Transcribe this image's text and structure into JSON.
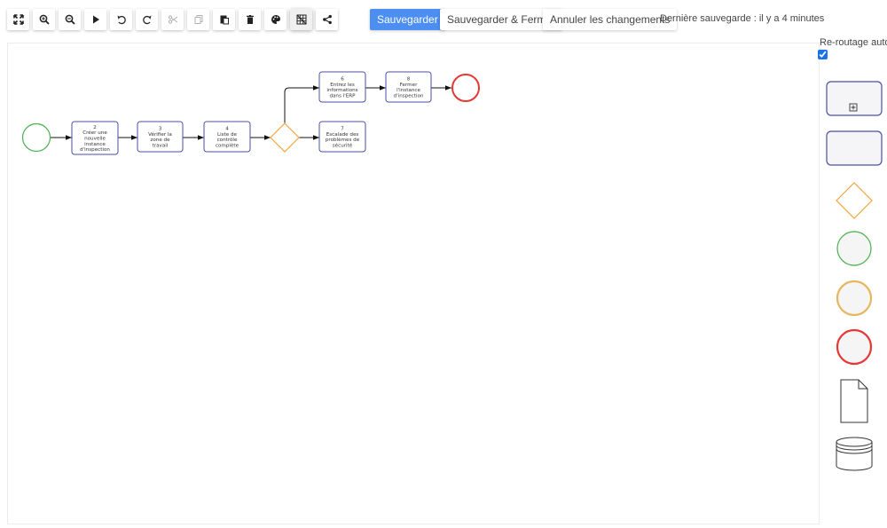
{
  "toolbar": {
    "buttons": [
      {
        "id": "fit",
        "icon": "fullscreen-icon"
      },
      {
        "id": "zoom-in",
        "icon": "zoom-in-icon"
      },
      {
        "id": "zoom-out",
        "icon": "zoom-out-icon"
      },
      {
        "id": "run",
        "icon": "play-icon"
      },
      {
        "id": "undo",
        "icon": "undo-icon"
      },
      {
        "id": "redo",
        "icon": "redo-icon"
      },
      {
        "id": "cut",
        "icon": "scissors-icon"
      },
      {
        "id": "copy",
        "icon": "copy-icon"
      },
      {
        "id": "paste",
        "icon": "paste-icon"
      },
      {
        "id": "delete",
        "icon": "trash-icon"
      },
      {
        "id": "color",
        "icon": "palette-icon"
      },
      {
        "id": "grid",
        "icon": "grid-icon"
      },
      {
        "id": "share",
        "icon": "share-icon"
      }
    ]
  },
  "actions": {
    "save": "Sauvegarder",
    "save_close": "Sauvegarder & Fermer",
    "cancel": "Annuler les changements"
  },
  "status": {
    "last_save": "Dernière sauvegarde : il y a 4 minutes"
  },
  "reroute": {
    "label": "Re-routage auto.",
    "checked": true
  },
  "colors": {
    "accent": "#4c8ef1",
    "task_border": "#4b4fa6",
    "gateway": "#f0a640",
    "start": "#4caf50",
    "end": "#e53935",
    "intermediate": "#e6b760"
  },
  "diagram": {
    "tasks": [
      {
        "id": "t2",
        "lines": [
          "2",
          "Créer une",
          "nouvelle",
          "instance",
          "d'inspection"
        ]
      },
      {
        "id": "t3",
        "lines": [
          "3",
          "Vérifier la",
          "zone de",
          "travail"
        ]
      },
      {
        "id": "t4",
        "lines": [
          "4",
          "Liste de",
          "contrôle",
          "complète"
        ]
      },
      {
        "id": "t6",
        "lines": [
          "6",
          "Entrez les",
          "informations",
          "dans l'ERP"
        ]
      },
      {
        "id": "t8",
        "lines": [
          "8",
          "Fermer",
          "l'instance",
          "d'inspection"
        ]
      },
      {
        "id": "t7",
        "lines": [
          "7",
          "Escalade des",
          "problèmes de",
          "sécurité"
        ]
      }
    ]
  },
  "palette": [
    {
      "id": "subprocess",
      "icon": "subprocess-icon"
    },
    {
      "id": "task",
      "icon": "task-icon"
    },
    {
      "id": "gateway",
      "icon": "gateway-icon"
    },
    {
      "id": "start-event",
      "icon": "start-event-icon"
    },
    {
      "id": "intermediate-event",
      "icon": "intermediate-event-icon"
    },
    {
      "id": "end-event",
      "icon": "end-event-icon"
    },
    {
      "id": "data-object",
      "icon": "document-icon"
    },
    {
      "id": "data-store",
      "icon": "database-icon"
    }
  ]
}
